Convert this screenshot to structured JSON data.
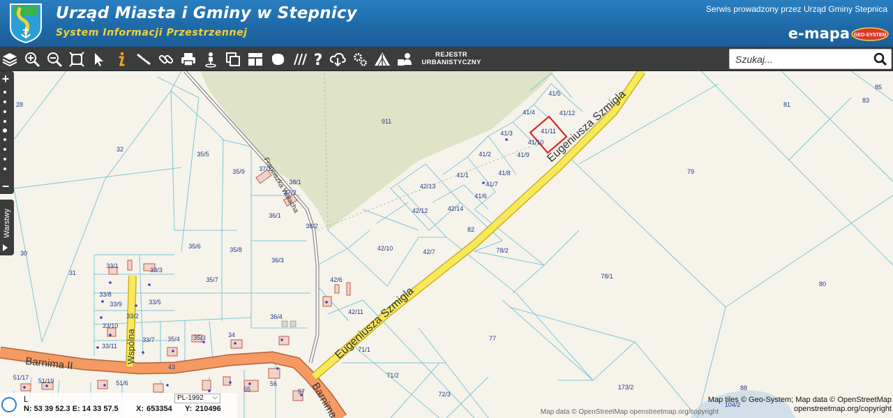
{
  "header": {
    "title": "Urząd Miasta i Gminy w Stepnicy",
    "subtitle": "System Informacji Przestrzennej",
    "service": "Serwis prowadzony przez Urząd Gminy Stepnica",
    "brand": "e-mapa",
    "geo_logo_text": "GEO-SYSTEM",
    "colors": {
      "header_blue": "#1f6aa8",
      "subtitle_yellow": "#f1d23a",
      "toolbar": "#3c3c3c"
    }
  },
  "toolbar": {
    "icons": [
      "layers-icon",
      "zoom-in-icon",
      "zoom-out-icon",
      "full-extent-icon",
      "pointer-icon",
      "info-icon",
      "measure-icon",
      "link-icon",
      "print-icon",
      "street-view-icon",
      "copy-icon",
      "layout-icon",
      "shape-icon",
      "hatch-icon",
      "help-icon",
      "cloud-download-icon",
      "settings-icon",
      "warning-icon",
      "user-group-icon"
    ],
    "rejestr_line1": "REJESTR",
    "rejestr_line2": "URBANISTYCZNY"
  },
  "search": {
    "placeholder": "Szukaj..."
  },
  "side": {
    "zoom_in": "+",
    "zoom_out": "−",
    "layers_tab": "Warstwy"
  },
  "map": {
    "parcels": [
      "28",
      "32",
      "35/5",
      "35/9",
      "37/1",
      "37/2",
      "38/1",
      "911",
      "41/5",
      "41/4",
      "41/12",
      "41/3",
      "41/11",
      "41/10",
      "41/2",
      "41/9",
      "41/8",
      "41/1",
      "41/7",
      "41/6",
      "42/13",
      "42/12",
      "42/14",
      "36/1",
      "38/2",
      "82",
      "35/6",
      "35/8",
      "36/3",
      "42/10",
      "42/7",
      "78/2",
      "30",
      "31",
      "33/1",
      "33/3",
      "35/7",
      "42/6",
      "33/8",
      "33/9",
      "33/5",
      "33/2",
      "36/4",
      "42/11",
      "33/10",
      "34",
      "33/11",
      "33/7",
      "35/4",
      "35/3",
      "71/1",
      "77",
      "43",
      "51/17",
      "51/19",
      "51/6",
      "56",
      "55",
      "57",
      "71/2",
      "72/3",
      "173/2",
      "88",
      "104/2",
      "85",
      "83",
      "81",
      "79",
      "78/1",
      "80"
    ],
    "streets": [
      "Eugeniusza Szmigla",
      "Eugeniusza Szmigla",
      "Barnima II",
      "Barnima",
      "Wspólna",
      "Franciszka Wałacha"
    ],
    "selected_parcel": "41/11",
    "colors": {
      "forest": "#dfe3c8",
      "main_road": "#f59a62",
      "secondary_road": "#f7e95a",
      "parcel_line": "#7fc6d4",
      "selection": "#d7282f"
    }
  },
  "status": {
    "line1": "L",
    "coord_ne": "N: 53 39 52.3   E: 14 33 57.5",
    "x_label": "X:",
    "x_value": "653354",
    "y_label": "Y:",
    "y_value": "210496",
    "crs": "PL-1992"
  },
  "attribution": {
    "tiles": "Map tiles © Geo-System; Map data © OpenStreetMap",
    "link": "openstreetmap.org/copyright",
    "osm": "Map data © OpenStreetMap openstreetmap.org/copyright"
  }
}
